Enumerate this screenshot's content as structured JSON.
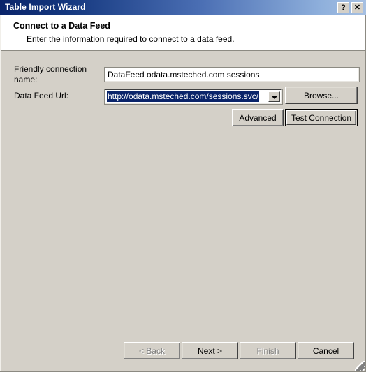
{
  "window": {
    "title": "Table Import Wizard",
    "help_button": "?",
    "close_button": "✕"
  },
  "header": {
    "title": "Connect to a Data Feed",
    "subtitle": "Enter the information required to connect to a data feed."
  },
  "form": {
    "friendly_name_label": "Friendly connection name:",
    "friendly_name_value": "DataFeed odata.msteched.com sessions",
    "data_feed_url_label": "Data Feed Url:",
    "data_feed_url_value": "http://odata.msteched.com/sessions.svc/",
    "browse_button": "Browse...",
    "advanced_button": "Advanced",
    "test_connection_button": "Test Connection"
  },
  "footer": {
    "back_button": "< Back",
    "next_button": "Next >",
    "finish_button": "Finish",
    "cancel_button": "Cancel"
  },
  "colors": {
    "titlebar_start": "#0a246a",
    "titlebar_end": "#a6c0e2",
    "dialog_background": "#d4d0c8",
    "selection_background": "#0a246a",
    "selection_text": "#ffffff",
    "disabled_text": "#808080"
  }
}
